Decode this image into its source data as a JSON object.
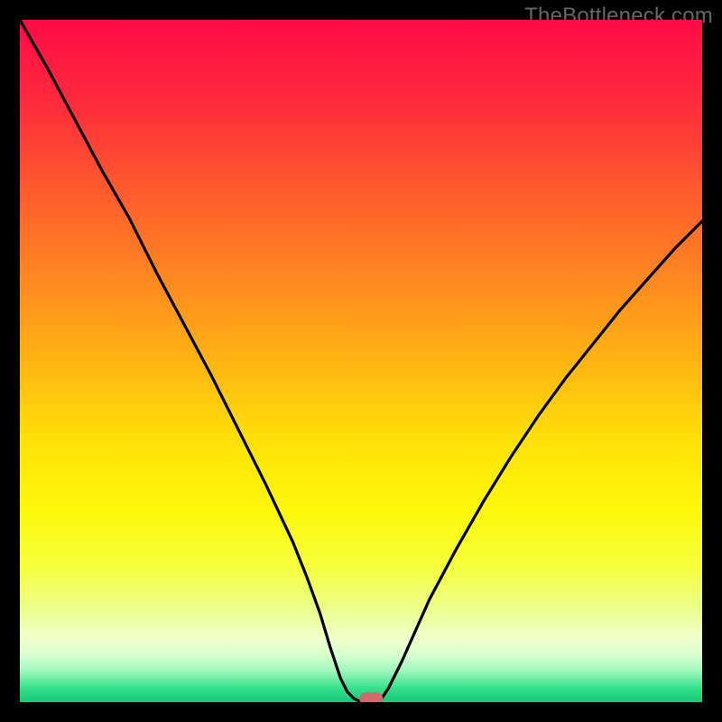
{
  "watermark": "TheBottleneck.com",
  "chart_data": {
    "type": "line",
    "title": "",
    "xlabel": "",
    "ylabel": "",
    "xlim": [
      0,
      100
    ],
    "ylim": [
      0,
      100
    ],
    "series": [
      {
        "name": "bottleneck-curve",
        "x": [
          0,
          4,
          8,
          12,
          16,
          20,
          24,
          28,
          32,
          36,
          40,
          42,
          44,
          45.5,
          47,
          48,
          49,
          50,
          51,
          52,
          53,
          54,
          56,
          60,
          64,
          68,
          72,
          76,
          80,
          84,
          88,
          92,
          96,
          100
        ],
        "y": [
          100,
          93,
          85.5,
          78,
          71,
          63,
          55.5,
          48,
          40,
          32,
          23.5,
          18.5,
          13,
          8,
          3.5,
          1.5,
          0.5,
          0,
          0,
          0,
          0.5,
          2,
          6,
          15,
          22.5,
          29.5,
          36,
          42,
          47.5,
          52.5,
          57.5,
          62,
          66.5,
          70.5
        ]
      }
    ],
    "marker": {
      "name": "optimum-marker",
      "x": 51.5,
      "y": 0.5,
      "color": "#cf6b6b"
    },
    "background": {
      "type": "vertical-gradient",
      "stops": [
        {
          "pos": 0.0,
          "color": "#ff0a46"
        },
        {
          "pos": 0.12,
          "color": "#ff2a3d"
        },
        {
          "pos": 0.25,
          "color": "#ff5a2e"
        },
        {
          "pos": 0.38,
          "color": "#ff8820"
        },
        {
          "pos": 0.5,
          "color": "#ffb412"
        },
        {
          "pos": 0.62,
          "color": "#ffe208"
        },
        {
          "pos": 0.72,
          "color": "#fdf80a"
        },
        {
          "pos": 0.8,
          "color": "#f6ff3a"
        },
        {
          "pos": 0.86,
          "color": "#ecff88"
        },
        {
          "pos": 0.905,
          "color": "#f0ffc8"
        },
        {
          "pos": 0.93,
          "color": "#d8ffd0"
        },
        {
          "pos": 0.955,
          "color": "#9cf7bb"
        },
        {
          "pos": 0.98,
          "color": "#35e08a"
        },
        {
          "pos": 1.0,
          "color": "#18c878"
        }
      ]
    }
  }
}
